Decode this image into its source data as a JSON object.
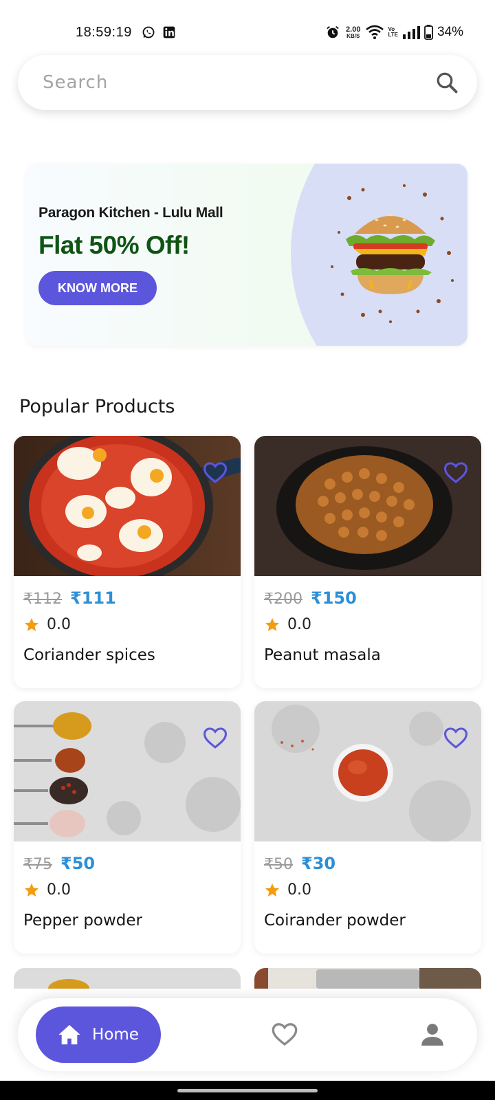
{
  "status_bar": {
    "time": "18:59:19",
    "net_speed_value": "2.00",
    "net_speed_unit": "KB/S",
    "volte_top": "Vo",
    "volte_bottom": "LTE",
    "battery": "34%"
  },
  "search": {
    "placeholder": "Search",
    "icon": "search-icon"
  },
  "banner": {
    "subtitle": "Paragon Kitchen - Lulu Mall",
    "title": "Flat 50% Off!",
    "button_label": "KNOW MORE",
    "title_color": "#0f5414",
    "button_color": "#5c56dc"
  },
  "section": {
    "popular_title": "Popular Products"
  },
  "products": [
    {
      "old_price": "₹112",
      "new_price": "₹111",
      "rating": "0.0",
      "name": "Coriander spices"
    },
    {
      "old_price": "₹200",
      "new_price": "₹150",
      "rating": "0.0",
      "name": "Peanut masala"
    },
    {
      "old_price": "₹75",
      "new_price": "₹50",
      "rating": "0.0",
      "name": "Pepper powder"
    },
    {
      "old_price": "₹50",
      "new_price": "₹30",
      "rating": "0.0",
      "name": "Coirander powder"
    }
  ],
  "bottom_nav": {
    "home_label": "Home",
    "accent": "#5c56dc",
    "icons": [
      "home-icon",
      "heart-icon",
      "person-icon"
    ]
  },
  "colors": {
    "price_new": "#2d8fd6",
    "star": "#f39c12",
    "heart": "#5c56dc"
  }
}
